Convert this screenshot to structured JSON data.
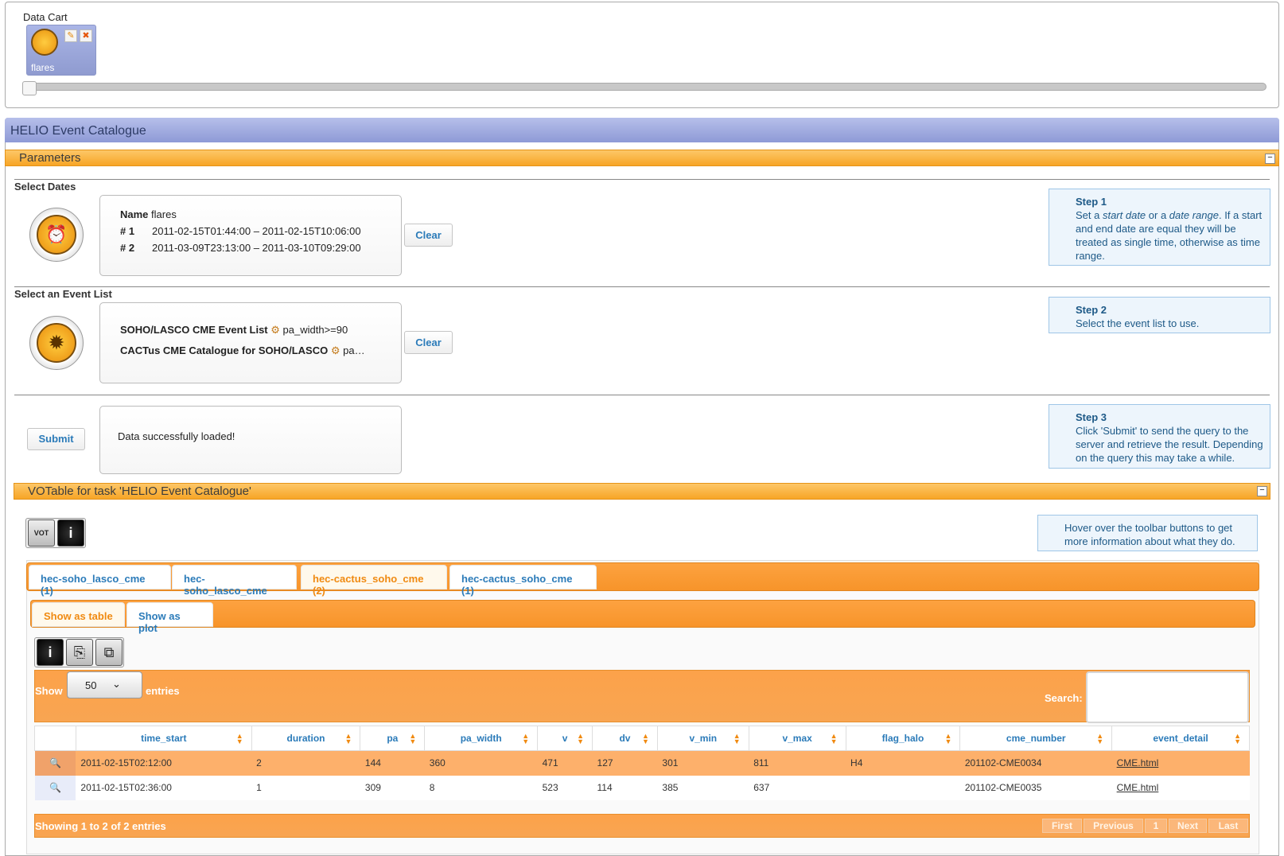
{
  "data_cart": {
    "title": "Data Cart",
    "item_label": "flares"
  },
  "helio": {
    "title": "HELIO Event Catalogue",
    "params_title": "Parameters"
  },
  "dates": {
    "section": "Select Dates",
    "name_label": "Name",
    "name_value": "flares",
    "rows": [
      {
        "n": "# 1",
        "v": "2011-02-15T01:44:00 – 2011-02-15T10:06:00"
      },
      {
        "n": "# 2",
        "v": "2011-03-09T23:13:00 – 2011-03-10T09:29:00"
      }
    ],
    "clear": "Clear"
  },
  "step1": {
    "title": "Step 1",
    "text_a": "Set a ",
    "em1": "start date",
    "text_b": " or a ",
    "em2": "date range",
    "text_c": ". If a start and end date are equal they will be treated as single time, otherwise as time range."
  },
  "events": {
    "section": "Select an Event List",
    "list1": "SOHO/LASCO CME Event List",
    "list1_param": "pa_width>=90",
    "list2": "CACTus CME Catalogue for SOHO/LASCO",
    "list2_param": "pa…",
    "clear": "Clear"
  },
  "step2": {
    "title": "Step 2",
    "text": "Select the event list to use."
  },
  "submit": {
    "button": "Submit",
    "status": "Data successfully loaded!"
  },
  "step3": {
    "title": "Step 3",
    "text": "Click 'Submit' to send the query to the server and retrieve the result. Depending on the query this may take a while."
  },
  "votable": {
    "title": "VOTable for task 'HELIO Event Catalogue'",
    "hint": "Hover over the toolbar buttons to get more information about what they do.",
    "save_icon_text": "VOT"
  },
  "tabs": [
    "hec-soho_lasco_cme (1)",
    "hec-soho_lasco_cme",
    "hec-cactus_soho_cme (2)",
    "hec-cactus_soho_cme (1)"
  ],
  "view_tabs": [
    "Show as table",
    "Show as plot"
  ],
  "table": {
    "show": "Show",
    "entries_value": "50",
    "entries": "entries",
    "search": "Search:",
    "columns": [
      "time_start",
      "duration",
      "pa",
      "pa_width",
      "v",
      "dv",
      "v_min",
      "v_max",
      "flag_halo",
      "cme_number",
      "event_detail"
    ],
    "rows": [
      [
        "2011-02-15T02:12:00",
        "2",
        "144",
        "360",
        "471",
        "127",
        "301",
        "811",
        "H4",
        "201102-CME0034",
        "CME.html"
      ],
      [
        "2011-02-15T02:36:00",
        "1",
        "309",
        "8",
        "523",
        "114",
        "385",
        "637",
        "",
        "201102-CME0035",
        "CME.html"
      ]
    ],
    "info": "Showing 1 to 2 of 2 entries",
    "pager": [
      "First",
      "Previous",
      "1",
      "Next",
      "Last"
    ]
  },
  "colors": {
    "accent_orange": "#f7a526",
    "header_blue": "#8e9ad6",
    "link_blue": "#2b7bb9"
  }
}
